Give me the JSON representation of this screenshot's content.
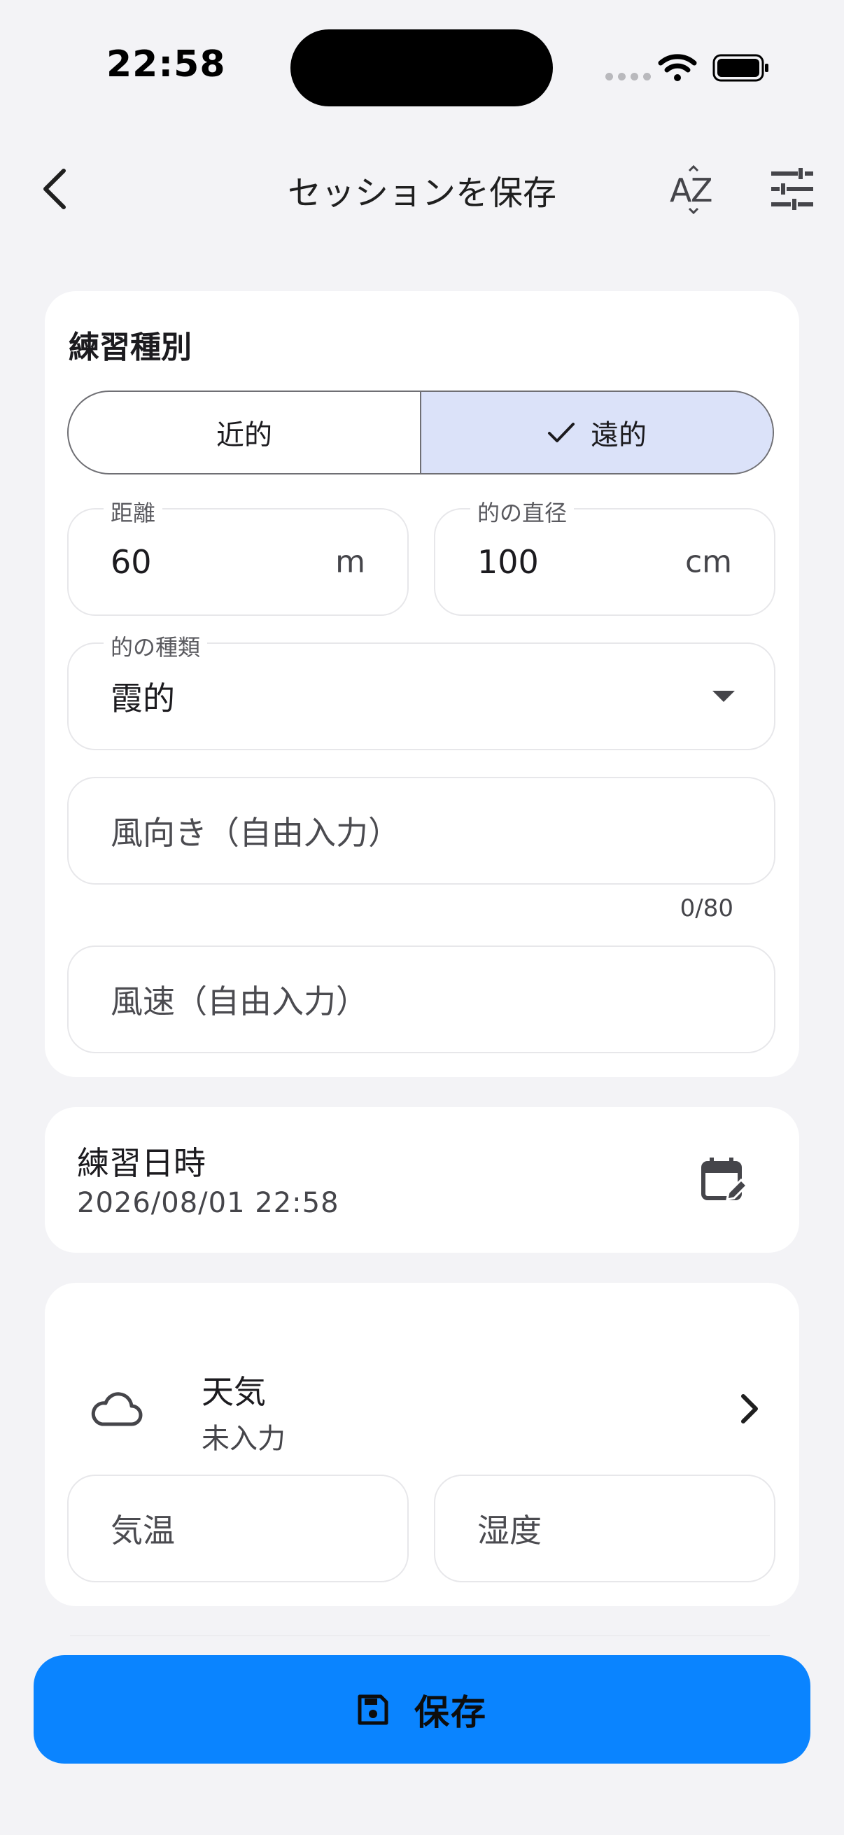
{
  "status_bar": {
    "time": "22:58"
  },
  "app_bar": {
    "title": "セッションを保存"
  },
  "practice_type": {
    "section_title": "練習種別",
    "options": [
      {
        "label": "近的",
        "selected": false
      },
      {
        "label": "遠的",
        "selected": true
      }
    ]
  },
  "distance": {
    "label": "距離",
    "value": "60",
    "unit": "m"
  },
  "target_diameter": {
    "label": "的の直径",
    "value": "100",
    "unit": "cm"
  },
  "target_type": {
    "label": "的の種類",
    "value": "霞的"
  },
  "wind_direction": {
    "placeholder": "風向き（自由入力）",
    "counter": "0/80"
  },
  "wind_speed": {
    "placeholder": "風速（自由入力）"
  },
  "practice_datetime": {
    "title": "練習日時",
    "value": "2026/08/01 22:58"
  },
  "weather": {
    "title": "天気",
    "status": "未入力"
  },
  "temperature": {
    "placeholder": "気温"
  },
  "humidity": {
    "placeholder": "湿度"
  },
  "save_button": {
    "label": "保存"
  },
  "colors": {
    "primary": "#0a84ff",
    "selected_segment": "#dbe2f9",
    "background": "#f3f3f6"
  }
}
